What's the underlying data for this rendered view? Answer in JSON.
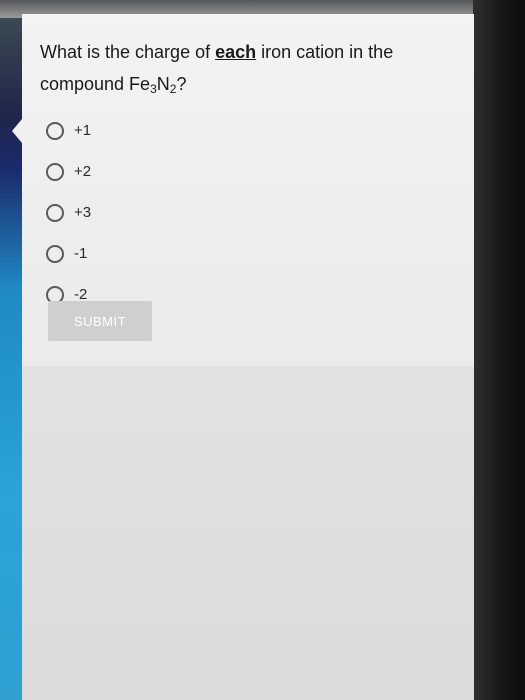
{
  "question": {
    "prefix": "What is the charge of ",
    "emphasis": "each",
    "suffix": " iron cation in the compound Fe",
    "sub1": "3",
    "mid": "N",
    "sub2": "2",
    "end": "?"
  },
  "options": [
    {
      "label": "+1",
      "selected": false
    },
    {
      "label": "+2",
      "selected": false
    },
    {
      "label": "+3",
      "selected": false
    },
    {
      "label": "-1",
      "selected": false
    },
    {
      "label": "-2",
      "selected": false
    }
  ],
  "submit": {
    "label": "SUBMIT",
    "enabled": false
  }
}
